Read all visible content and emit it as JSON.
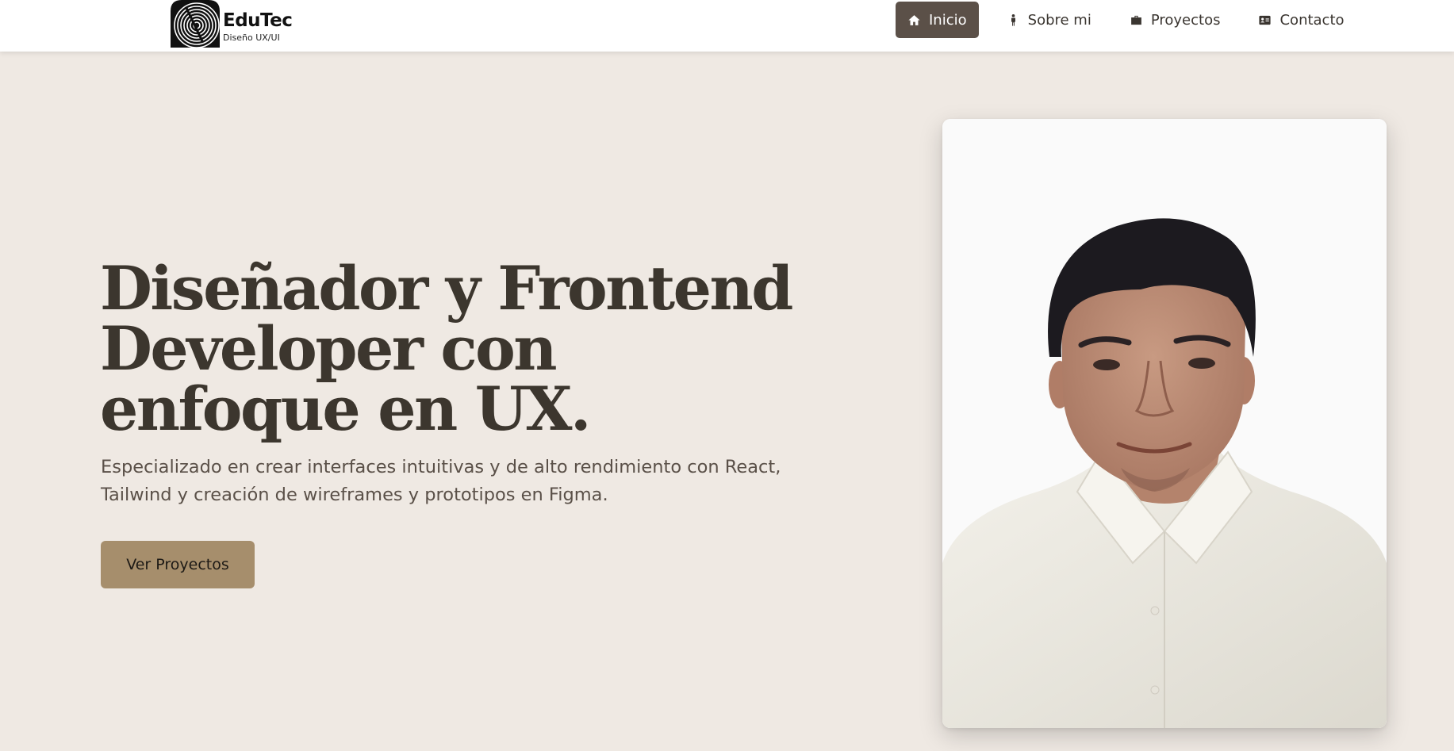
{
  "brand": {
    "name": "EduTec",
    "tagline": "Diseño UX/UI"
  },
  "nav": {
    "items": [
      {
        "label": "Inicio",
        "icon": "home-icon",
        "active": true
      },
      {
        "label": "Sobre mi",
        "icon": "person-icon",
        "active": false
      },
      {
        "label": "Proyectos",
        "icon": "briefcase-icon",
        "active": false
      },
      {
        "label": "Contacto",
        "icon": "contact-card-icon",
        "active": false
      }
    ]
  },
  "hero": {
    "title": "Diseñador y Frontend Developer con enfoque en UX.",
    "subtitle": "Especializado en crear interfaces intuitivas y de alto rendimiento con React, Tailwind y creación de wireframes y prototipos en Figma.",
    "cta_label": "Ver Proyectos"
  },
  "colors": {
    "page_background": "#efe9e3",
    "header_background": "#ffffff",
    "nav_active": "#5b5048",
    "title_text": "#3c362e",
    "body_text": "#5a5048",
    "cta_background": "#a68e6c"
  }
}
